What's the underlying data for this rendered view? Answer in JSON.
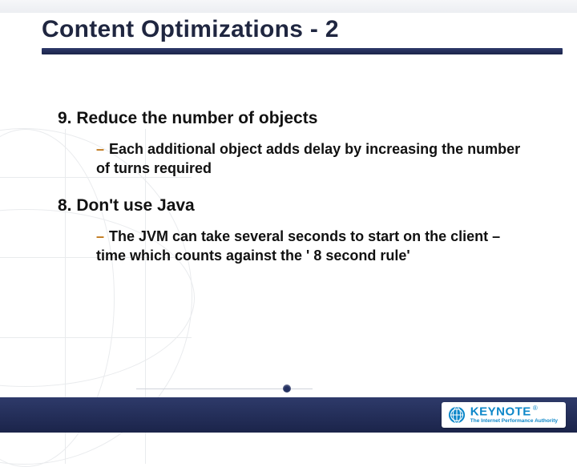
{
  "title": "Content Optimizations - 2",
  "points": [
    {
      "heading": "9. Reduce the number of objects",
      "sub": "Each additional object adds delay by increasing the number of turns required"
    },
    {
      "heading": "8. Don't use Java",
      "sub": "The JVM can take several seconds to start on the client – time which counts against the ' 8 second rule'"
    }
  ],
  "logo": {
    "word": "KEYNOTE",
    "tagline": "The Internet Performance Authority"
  },
  "colors": {
    "navy": "#1f2a52",
    "accent_bullet": "#c0781a",
    "keynote_blue": "#0d87c9"
  }
}
